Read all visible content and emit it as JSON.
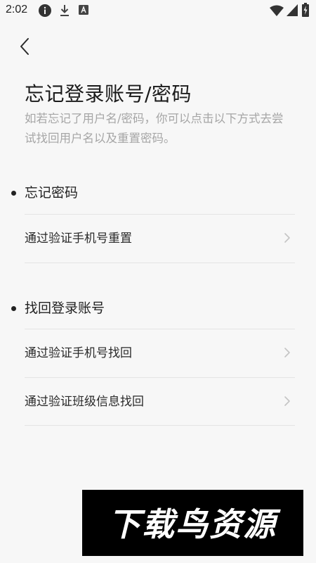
{
  "status_bar": {
    "time": "2:02",
    "icons": [
      "info-icon",
      "download-icon",
      "font-a-icon",
      "wifi-icon",
      "signal-icon",
      "battery-charging-icon"
    ]
  },
  "header": {
    "back_icon": "chevron-left-icon",
    "title": "忘记登录账号/密码",
    "description": "如若忘记了用户名/密码，你可以点击以下方式去尝试找回用户名以及重置密码。"
  },
  "sections": [
    {
      "title": "忘记密码",
      "items": [
        {
          "label": "通过验证手机号重置"
        }
      ]
    },
    {
      "title": "找回登录账号",
      "items": [
        {
          "label": "通过验证手机号找回"
        },
        {
          "label": "通过验证班级信息找回"
        }
      ]
    }
  ],
  "watermark": {
    "text": "下载鸟资源"
  }
}
